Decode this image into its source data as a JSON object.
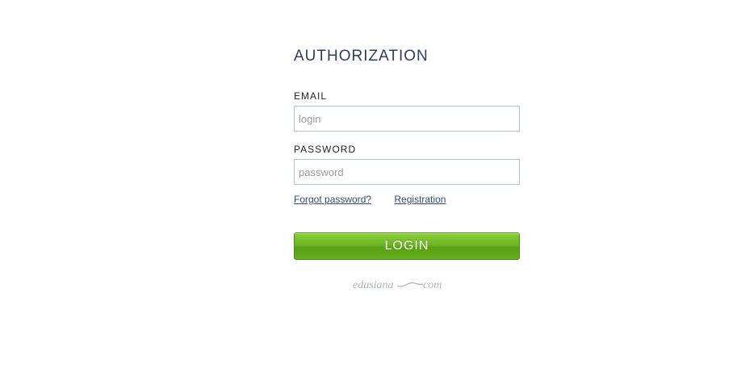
{
  "auth": {
    "title": "AUTHORIZATION",
    "email_label": "EMAIL",
    "email_placeholder": "login",
    "password_label": "PASSWORD",
    "password_placeholder": "password",
    "forgot_link": "Forgot password?",
    "registration_link": "Registration",
    "login_button": "LOGIN"
  },
  "brand": {
    "text_left": "edusiana",
    "text_right": "com"
  },
  "colors": {
    "title": "#2c3e60",
    "link": "#2d4a78",
    "button_green": "#6cb423",
    "input_border": "#b7c3c7",
    "brand_gray": "#a9b2ba"
  }
}
